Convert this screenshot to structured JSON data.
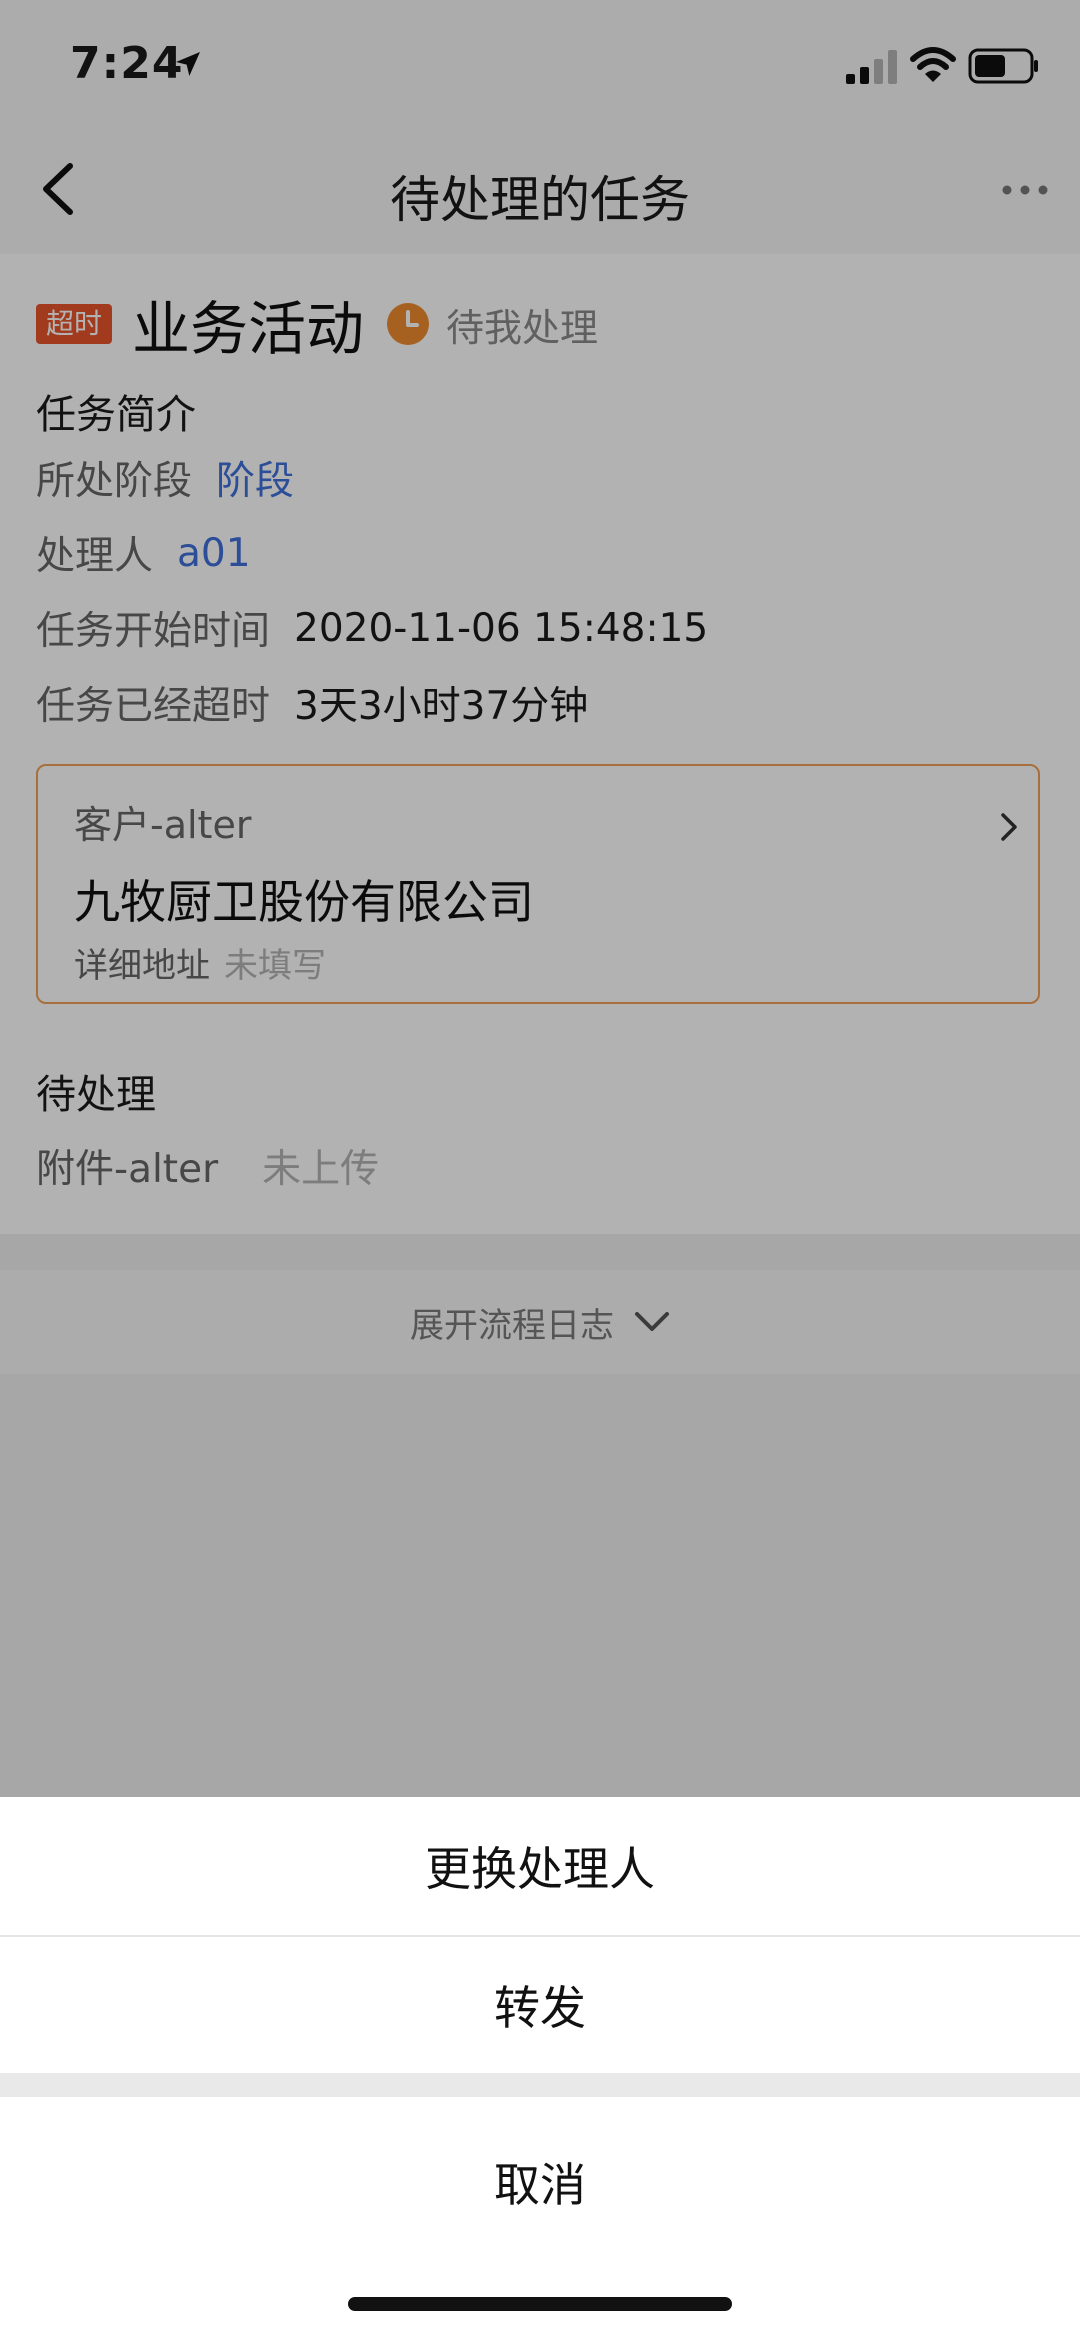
{
  "status_bar": {
    "time": "7:24"
  },
  "nav": {
    "title": "待处理的任务"
  },
  "task": {
    "badge": "超时",
    "title": "业务活动",
    "status": "待我处理",
    "summary_heading": "任务简介",
    "fields": [
      {
        "label": "所处阶段",
        "value": "阶段"
      },
      {
        "label": "处理人",
        "value": "a01"
      },
      {
        "label": "任务开始时间",
        "value": "2020-11-06 15:48:15"
      },
      {
        "label": "任务已经超时",
        "value": "3天3小时37分钟"
      }
    ]
  },
  "customer_card": {
    "label": "客户-alter",
    "company": "九牧厨卫股份有限公司",
    "address_label": "详细地址",
    "address_value": "未填写"
  },
  "pending": {
    "heading": "待处理",
    "attachment_label": "附件-alter",
    "attachment_value": "未上传"
  },
  "flow_log": {
    "expand_label": "展开流程日志"
  },
  "action_sheet": {
    "change_handler": "更换处理人",
    "forward": "转发",
    "cancel": "取消"
  },
  "colors": {
    "overdue_badge": "#e8532b",
    "link_blue": "#3f6fd8",
    "card_border": "#f0a055",
    "clock_orange": "#ee8a2e"
  },
  "icons": [
    "location-arrow-icon",
    "signal-icon",
    "wifi-icon",
    "battery-icon",
    "back-chevron-icon",
    "more-icon",
    "clock-icon",
    "chevron-right-icon",
    "chevron-down-icon"
  ]
}
